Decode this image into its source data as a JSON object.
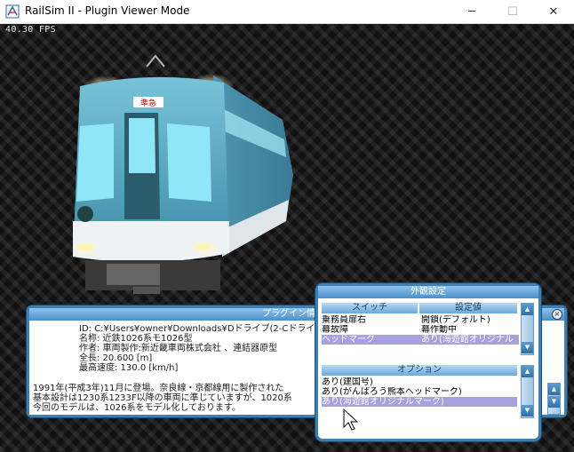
{
  "window": {
    "title": "RailSim II - Plugin Viewer Mode",
    "buttons": {
      "minimize": "─",
      "maximize": "☐",
      "close": "✕"
    }
  },
  "viewport": {
    "fps": "40.30 FPS"
  },
  "train": {
    "destination": "準急",
    "body_color": "#5aa7c0",
    "light_color": "#f6e69a"
  },
  "info_panel": {
    "title": "プラグイン情",
    "id": "ID: C:¥Users¥owner¥Downloads¥Dドライブ(2-Cドライ",
    "name": "名称: 近鉄1026系モ1026型",
    "author": "作者: 車両製作:新近畿車両株式会社 、連結器原型",
    "length": "全長: 20.600 [m]",
    "max_speed": "最高速度: 130.0 [km/h]",
    "desc1": "1991年(平成3年)11月に登場。奈良線・京都線用に製作された",
    "desc2": "基本設計は1230系1233F以降の車両に準じていますが、1020系",
    "desc3": "今回のモデルは、1026系をモデル化しております。"
  },
  "appearance": {
    "title": "外観設定",
    "switch_header": "スイッチ",
    "value_header": "設定値",
    "switches": [
      {
        "name": "乗務員扉右",
        "value": "開鎖(デフォルト)"
      },
      {
        "name": "幕故障",
        "value": "幕作動中"
      },
      {
        "name": "ヘッドマーク",
        "value": "あり(海遊館オリジナル"
      }
    ],
    "options_header": "オプション",
    "options": [
      "あり(建国号)",
      "あり(がんばろう熊本ヘッドマーク)",
      "あり(海遊館オリジナルマーク)"
    ],
    "selected_switch": 2,
    "selected_option": 2
  },
  "colors": {
    "panel_border": "#3c7fb0",
    "selection": "#a7a2de",
    "panel_header": "#5b9bd5"
  }
}
